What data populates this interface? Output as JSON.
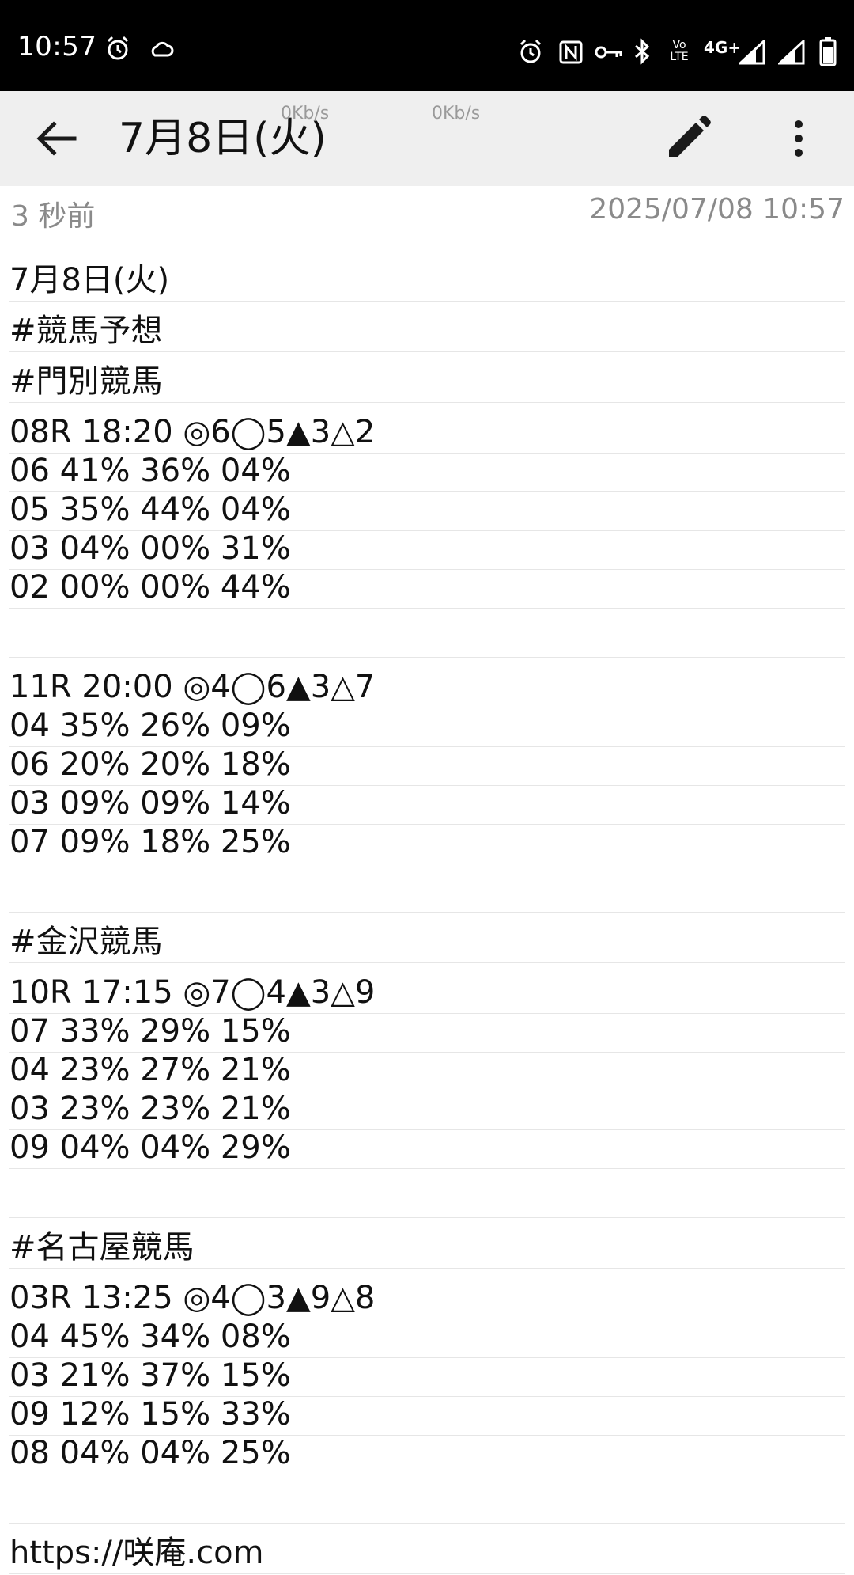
{
  "status_bar": {
    "time": "10:57",
    "left_icons": [
      "alarm-icon",
      "cloud-icon"
    ],
    "right_icons": [
      "alarm-icon",
      "nfc-icon",
      "vpn-key-icon",
      "bluetooth-icon",
      "volte-icon",
      "4g-plus-icon",
      "signal-icon",
      "signal-icon",
      "battery-icon"
    ],
    "volte_top": "Vo",
    "volte_bottom": "LTE",
    "network": "4G+"
  },
  "app_bar": {
    "title": "7月8日(火)",
    "speed_1": "0Kb/s",
    "speed_2": "0Kb/s"
  },
  "note_meta": {
    "relative_time": "3 秒前",
    "timestamp": "2025/07/08 10:57"
  },
  "note_lines": [
    "7月8日(火)",
    "#競馬予想",
    "#門別競馬",
    "08R 18:20 ◎6◯5▲3△2",
    "06 41% 36% 04%",
    "05 35% 44% 04%",
    "03 04% 00% 31%",
    "02 00% 00% 44%",
    "",
    "11R 20:00 ◎4◯6▲3△7",
    "04 35% 26% 09%",
    "06 20% 20% 18%",
    "03 09% 09% 14%",
    "07 09% 18% 25%",
    "",
    "#金沢競馬",
    "10R 17:15 ◎7◯4▲3△9",
    "07 33% 29% 15%",
    "04 23% 27% 21%",
    "03 23% 23% 21%",
    "09 04% 04% 29%",
    "",
    "#名古屋競馬",
    "03R 13:25 ◎4◯3▲9△8",
    "04 45% 34% 08%",
    "03 21% 37% 15%",
    "09 12% 15% 33%",
    "08 04% 04% 25%",
    "",
    "https://咲庵.com"
  ]
}
